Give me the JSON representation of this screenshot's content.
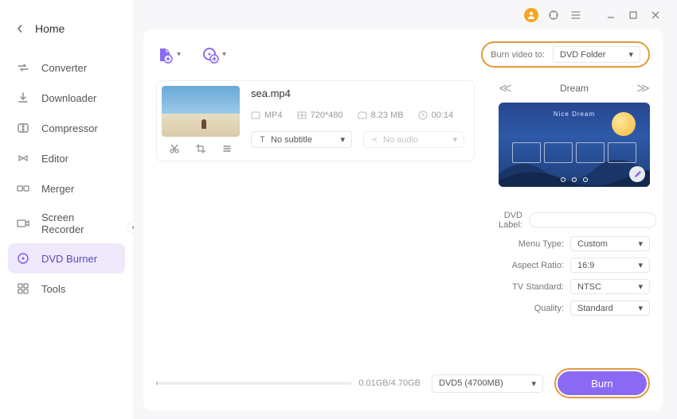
{
  "home_label": "Home",
  "sidebar": {
    "items": [
      {
        "label": "Converter"
      },
      {
        "label": "Downloader"
      },
      {
        "label": "Compressor"
      },
      {
        "label": "Editor"
      },
      {
        "label": "Merger"
      },
      {
        "label": "Screen Recorder"
      },
      {
        "label": "DVD Burner"
      },
      {
        "label": "Tools"
      }
    ],
    "active_index": 6
  },
  "burn_target": {
    "label": "Burn video to:",
    "value": "DVD Folder"
  },
  "file": {
    "name": "sea.mp4",
    "format": "MP4",
    "resolution": "720*480",
    "size": "8.23 MB",
    "duration": "00:14",
    "subtitle": "No subtitle",
    "audio": "No audio"
  },
  "menu": {
    "name": "Dream",
    "preview_title": "Nice Dream"
  },
  "settings": {
    "labels": {
      "dvd_label": "DVD Label:",
      "menu_type": "Menu Type:",
      "aspect_ratio": "Aspect Ratio:",
      "tv_standard": "TV Standard:",
      "quality": "Quality:"
    },
    "dvd_label": "",
    "menu_type": "Custom",
    "aspect_ratio": "16:9",
    "tv_standard": "NTSC",
    "quality": "Standard"
  },
  "footer": {
    "progress_text": "0.01GB/4.70GB",
    "disc": "DVD5 (4700MB)",
    "burn": "Burn"
  },
  "colors": {
    "accent": "#8b6af3",
    "highlight": "#e09a3c",
    "active_bg": "#eee8fa"
  }
}
